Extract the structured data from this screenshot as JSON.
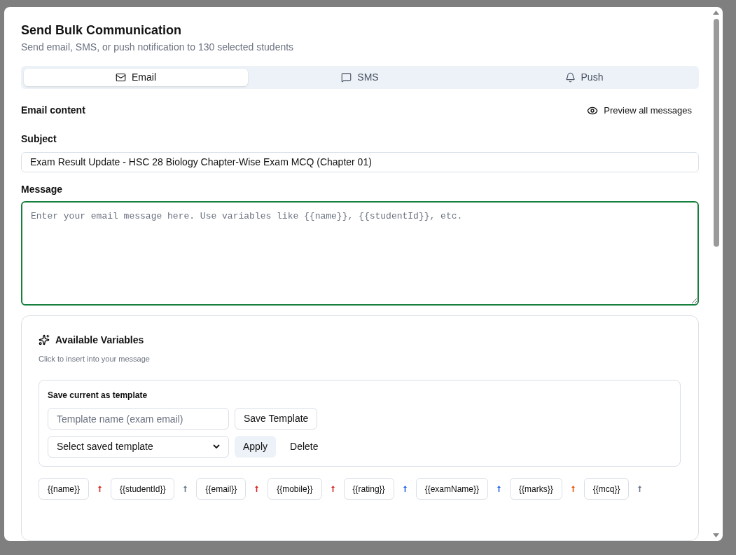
{
  "dialog": {
    "title": "Send Bulk Communication",
    "description": "Send email, SMS, or push notification to 130 selected students"
  },
  "tabs": [
    {
      "label": "Email",
      "selected": true
    },
    {
      "label": "SMS",
      "selected": false
    },
    {
      "label": "Push",
      "selected": false
    }
  ],
  "content_header": {
    "title": "Email content",
    "preview_button": "Preview all messages"
  },
  "subject": {
    "label": "Subject",
    "value": "Exam Result Update - HSC 28 Biology Chapter-Wise Exam MCQ (Chapter 01)"
  },
  "message": {
    "label": "Message",
    "placeholder": "Enter your email message here. Use variables like {{name}}, {{studentId}}, etc.",
    "focused": true
  },
  "variables_panel": {
    "title": "Available Variables",
    "subtitle": "Click to insert into your message",
    "template": {
      "title": "Save current as template",
      "name_placeholder": "Template name (exam email)",
      "save_button": "Save Template",
      "select_value": "Select saved template",
      "apply_button": "Apply",
      "delete_button": "Delete"
    },
    "variables": [
      {
        "label": "{{name}}",
        "color": "#dc2626"
      },
      {
        "label": "{{studentId}}",
        "color": "#64748b"
      },
      {
        "label": "{{email}}",
        "color": "#dc2626"
      },
      {
        "label": "{{mobile}}",
        "color": "#dc2626"
      },
      {
        "label": "{{rating}}",
        "color": "#2563eb"
      },
      {
        "label": "{{examName}}",
        "color": "#2563eb"
      },
      {
        "label": "{{marks}}",
        "color": "#ea580c"
      },
      {
        "label": "{{mcq}}",
        "color": "#64748b"
      }
    ]
  }
}
